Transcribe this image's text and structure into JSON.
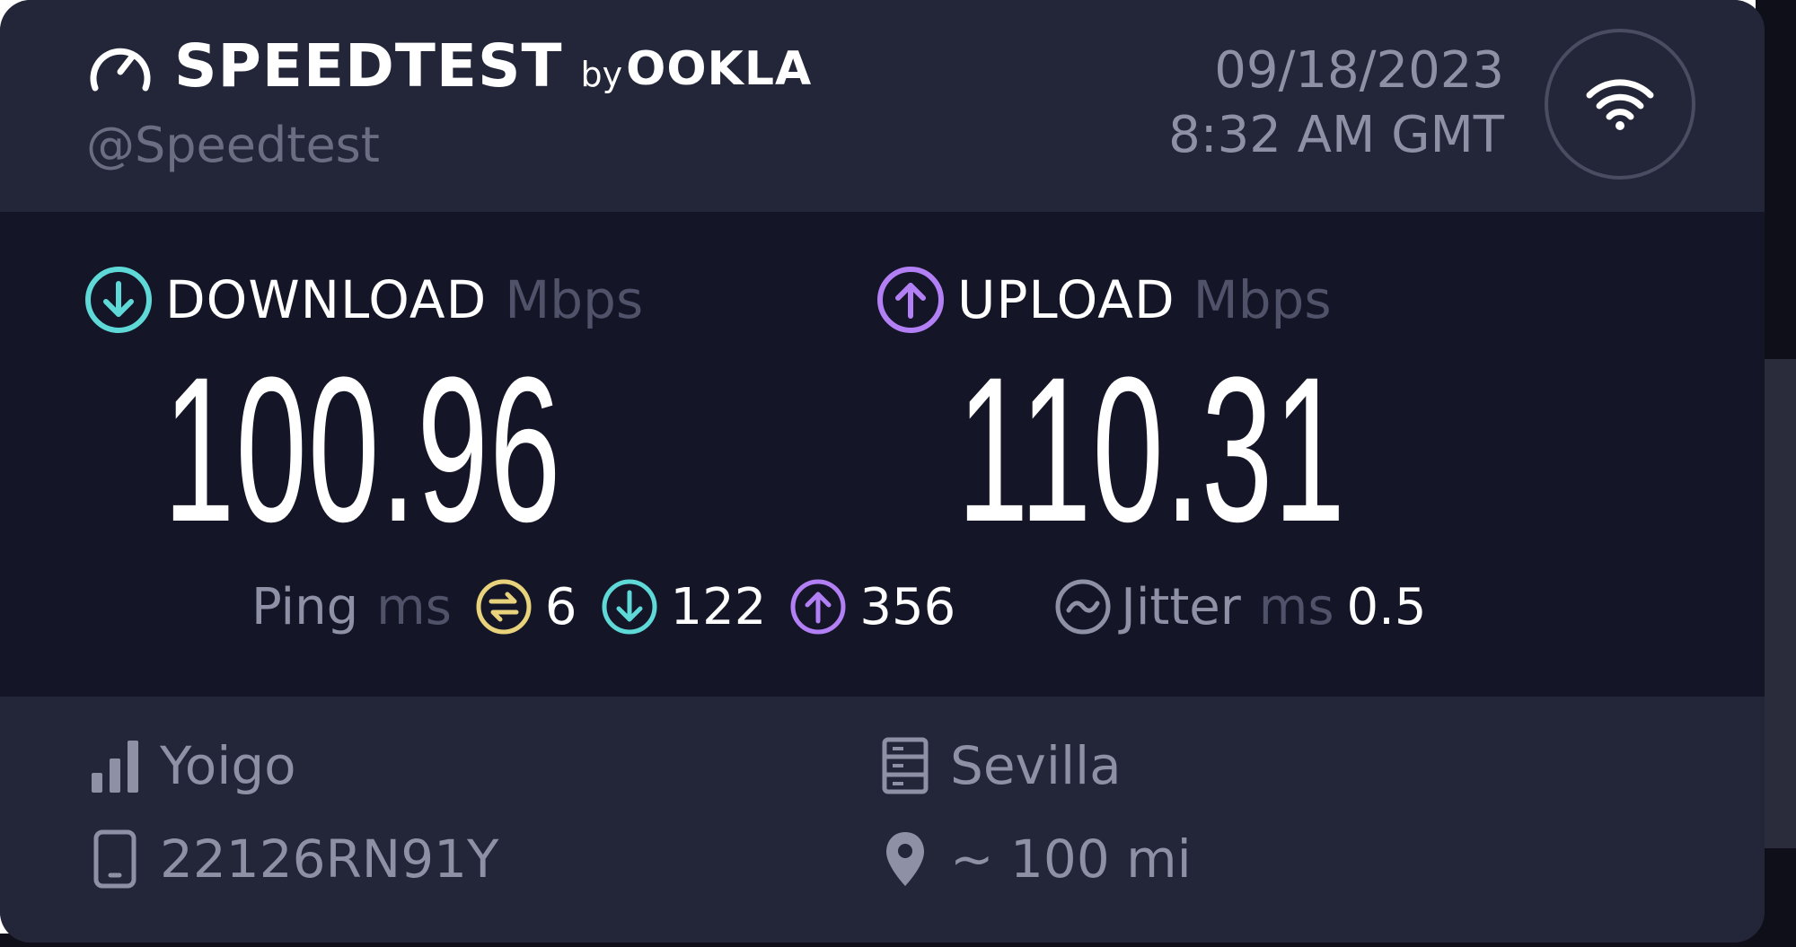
{
  "brand": {
    "name": "SPEEDTEST",
    "by": "by",
    "company": "OOKLA",
    "handle": "@Speedtest"
  },
  "timestamp": {
    "date": "09/18/2023",
    "time": "8:32 AM GMT"
  },
  "download": {
    "label": "DOWNLOAD",
    "unit": "Mbps",
    "value": "100.96",
    "icon": "download-arrow-icon",
    "color": "#5fd8d8"
  },
  "upload": {
    "label": "UPLOAD",
    "unit": "Mbps",
    "value": "110.31",
    "icon": "upload-arrow-icon",
    "color": "#b27ff5"
  },
  "ping": {
    "label": "Ping",
    "unit": "ms",
    "idle": "6",
    "download": "122",
    "upload": "356",
    "idle_color": "#e8d27c"
  },
  "jitter": {
    "label": "Jitter",
    "unit": "ms",
    "value": "0.5"
  },
  "provider": {
    "name": "Yoigo",
    "icon": "signal-bars-icon"
  },
  "device": {
    "model": "22126RN91Y",
    "icon": "phone-icon"
  },
  "server": {
    "name": "Sevilla",
    "icon": "server-icon"
  },
  "distance": {
    "value": "~ 100 mi",
    "icon": "location-pin-icon"
  },
  "connection": {
    "icon": "wifi-icon"
  }
}
